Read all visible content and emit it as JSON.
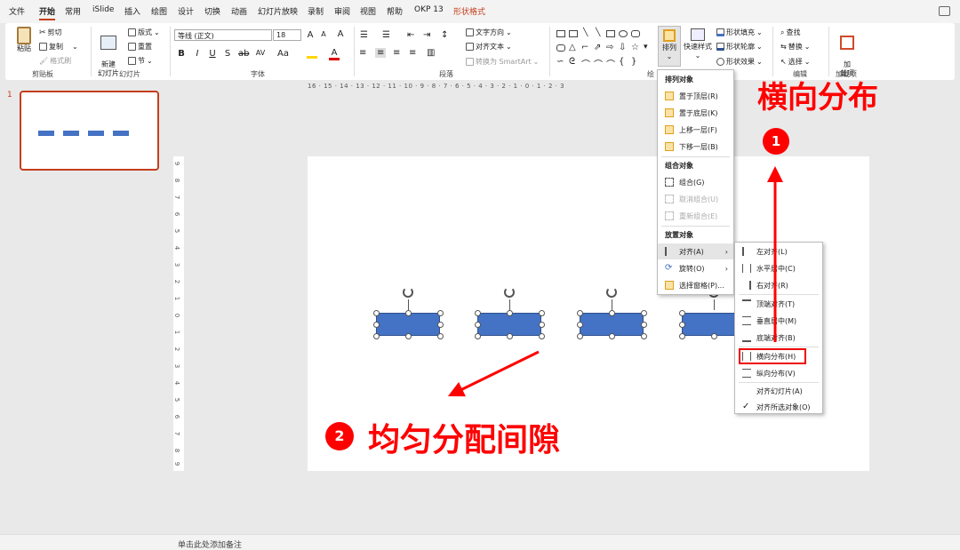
{
  "tabs": [
    "文件",
    "开始",
    "常用",
    "iSlide",
    "插入",
    "绘图",
    "设计",
    "切换",
    "动画",
    "幻灯片放映",
    "录制",
    "审阅",
    "视图",
    "帮助",
    "OKP 13",
    "形状格式"
  ],
  "clipboard": {
    "paste": "粘贴",
    "cut": "剪切",
    "copy": "复制",
    "format_painter": "格式刷",
    "group": "剪贴板"
  },
  "slides": {
    "new_slide": "新建\n幻灯片",
    "layout": "版式",
    "reset": "重置",
    "section": "节",
    "group": "幻灯片"
  },
  "font": {
    "name": "等线 (正文)",
    "size": "18",
    "group": "字体"
  },
  "paragraph": {
    "text_direction": "文字方向",
    "align_text": "对齐文本",
    "smartart": "转换为 SmartArt",
    "group": "段落"
  },
  "drawing": {
    "arrange": "排列",
    "quick_styles": "快速样式",
    "fill": "形状填充",
    "outline": "形状轮廓",
    "effects": "形状效果",
    "group": "绘"
  },
  "editing": {
    "find": "查找",
    "replace": "替换",
    "select": "选择",
    "group": "编辑"
  },
  "addins": {
    "label": "加\n载项",
    "group": "加载项"
  },
  "slide_number": "1",
  "hruler": "16 · 15 · 14 · 13 · 12 · 11 · 10 · 9 · 8 · 7 · 6 · 5 · 4 · 3 · 2 · 1 · 0 · 1 · 2 · 3",
  "vruler": [
    "9",
    "8",
    "7",
    "6",
    "5",
    "4",
    "3",
    "2",
    "1",
    "0",
    "1",
    "2",
    "3",
    "4",
    "5",
    "6",
    "7",
    "8",
    "9"
  ],
  "arrange_menu": {
    "header_order": "排列对象",
    "bring_front": "置于顶层(R)",
    "send_back": "置于底层(K)",
    "bring_forward": "上移一层(F)",
    "send_backward": "下移一层(B)",
    "header_group": "组合对象",
    "group": "组合(G)",
    "ungroup": "取消组合(U)",
    "regroup": "重新组合(E)",
    "header_position": "放置对象",
    "align": "对齐(A)",
    "rotate": "旋转(O)",
    "selection_pane": "选择窗格(P)..."
  },
  "align_menu": {
    "left": "左对齐(L)",
    "center": "水平居中(C)",
    "right": "右对齐(R)",
    "top": "顶端对齐(T)",
    "middle": "垂直居中(M)",
    "bottom": "底端对齐(B)",
    "dist_h": "横向分布(H)",
    "dist_v": "纵向分布(V)",
    "to_slide": "对齐幻灯片(A)",
    "to_selected": "对齐所选对象(O)"
  },
  "annotations": {
    "step1_num": "1",
    "step1_text": "横向分布",
    "step2_num": "2",
    "step2_text": "均匀分配间隙"
  },
  "notes_placeholder": "单击此处添加备注",
  "colors": {
    "accent": "#c43e1c",
    "shape_fill": "#4472c4",
    "annotation": "#ff0000"
  }
}
